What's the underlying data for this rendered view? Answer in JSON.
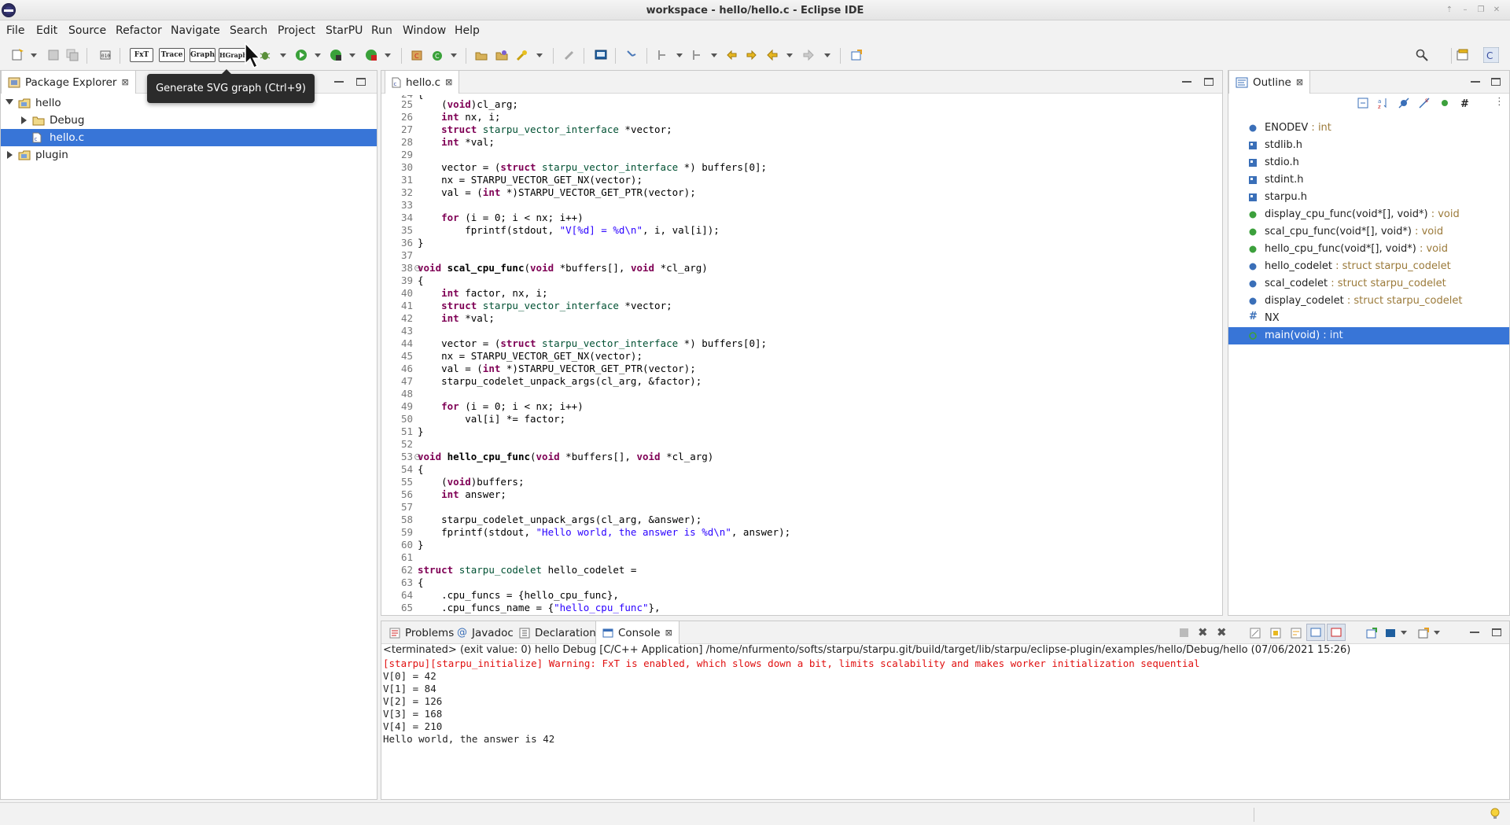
{
  "window": {
    "title": "workspace - hello/hello.c - Eclipse IDE"
  },
  "menubar": [
    "File",
    "Edit",
    "Source",
    "Refactor",
    "Navigate",
    "Search",
    "Project",
    "StarPU",
    "Run",
    "Window",
    "Help"
  ],
  "toolbar": {
    "starpu_buttons": [
      "FxT",
      "Trace",
      "Graph",
      "HGraph"
    ],
    "tooltip": "Generate SVG graph (Ctrl+9)"
  },
  "package_explorer": {
    "tab_label": "Package Explorer",
    "items": [
      {
        "label": "hello",
        "indent": 0,
        "expanded": true,
        "icon": "project-icon"
      },
      {
        "label": "Debug",
        "indent": 1,
        "expanded": false,
        "icon": "folder-icon"
      },
      {
        "label": "hello.c",
        "indent": 1,
        "selected": true,
        "icon": "c-file-icon"
      },
      {
        "label": "plugin",
        "indent": 0,
        "expanded": false,
        "icon": "project-icon"
      }
    ]
  },
  "editor": {
    "tab_label": "hello.c",
    "lines": [
      {
        "n": "25",
        "t": "    (void)cl_arg;"
      },
      {
        "n": "26",
        "t": "    int nx, i;"
      },
      {
        "n": "27",
        "t": "    struct starpu_vector_interface *vector;"
      },
      {
        "n": "28",
        "t": "    int *val;"
      },
      {
        "n": "29",
        "t": ""
      },
      {
        "n": "30",
        "t": "    vector = (struct starpu_vector_interface *) buffers[0];"
      },
      {
        "n": "31",
        "t": "    nx = STARPU_VECTOR_GET_NX(vector);"
      },
      {
        "n": "32",
        "t": "    val = (int *)STARPU_VECTOR_GET_PTR(vector);"
      },
      {
        "n": "33",
        "t": ""
      },
      {
        "n": "34",
        "t": "    for (i = 0; i < nx; i++)"
      },
      {
        "n": "35",
        "t": "        fprintf(stdout, \"V[%d] = %d\\n\", i, val[i]);"
      },
      {
        "n": "36",
        "t": "}"
      },
      {
        "n": "37",
        "t": ""
      },
      {
        "n": "38",
        "t": "void scal_cpu_func(void *buffers[], void *cl_arg)",
        "fold": true
      },
      {
        "n": "39",
        "t": "{"
      },
      {
        "n": "40",
        "t": "    int factor, nx, i;"
      },
      {
        "n": "41",
        "t": "    struct starpu_vector_interface *vector;"
      },
      {
        "n": "42",
        "t": "    int *val;"
      },
      {
        "n": "43",
        "t": ""
      },
      {
        "n": "44",
        "t": "    vector = (struct starpu_vector_interface *) buffers[0];"
      },
      {
        "n": "45",
        "t": "    nx = STARPU_VECTOR_GET_NX(vector);"
      },
      {
        "n": "46",
        "t": "    val = (int *)STARPU_VECTOR_GET_PTR(vector);"
      },
      {
        "n": "47",
        "t": "    starpu_codelet_unpack_args(cl_arg, &factor);"
      },
      {
        "n": "48",
        "t": ""
      },
      {
        "n": "49",
        "t": "    for (i = 0; i < nx; i++)"
      },
      {
        "n": "50",
        "t": "        val[i] *= factor;"
      },
      {
        "n": "51",
        "t": "}"
      },
      {
        "n": "52",
        "t": ""
      },
      {
        "n": "53",
        "t": "void hello_cpu_func(void *buffers[], void *cl_arg)",
        "fold": true
      },
      {
        "n": "54",
        "t": "{"
      },
      {
        "n": "55",
        "t": "    (void)buffers;"
      },
      {
        "n": "56",
        "t": "    int answer;"
      },
      {
        "n": "57",
        "t": ""
      },
      {
        "n": "58",
        "t": "    starpu_codelet_unpack_args(cl_arg, &answer);"
      },
      {
        "n": "59",
        "t": "    fprintf(stdout, \"Hello world, the answer is %d\\n\", answer);"
      },
      {
        "n": "60",
        "t": "}"
      },
      {
        "n": "61",
        "t": ""
      },
      {
        "n": "62",
        "t": "struct starpu_codelet hello_codelet ="
      },
      {
        "n": "63",
        "t": "{"
      },
      {
        "n": "64",
        "t": "    .cpu_funcs = {hello_cpu_func},"
      },
      {
        "n": "65",
        "t": "    .cpu_funcs_name = {\"hello_cpu_func\"},"
      }
    ]
  },
  "outline": {
    "tab_label": "Outline",
    "items": [
      {
        "name": "ENODEV",
        "type": " : int",
        "icon": "field-icon",
        "color": "#3a6fb8"
      },
      {
        "name": "stdlib.h",
        "type": "",
        "icon": "include-icon",
        "color": "#3a6fb8"
      },
      {
        "name": "stdio.h",
        "type": "",
        "icon": "include-icon",
        "color": "#3a6fb8"
      },
      {
        "name": "stdint.h",
        "type": "",
        "icon": "include-icon",
        "color": "#3a6fb8"
      },
      {
        "name": "starpu.h",
        "type": "",
        "icon": "include-icon",
        "color": "#3a6fb8"
      },
      {
        "name": "display_cpu_func(void*[], void*)",
        "type": " : void",
        "icon": "function-icon",
        "color": "#3ca03c"
      },
      {
        "name": "scal_cpu_func(void*[], void*)",
        "type": " : void",
        "icon": "function-icon",
        "color": "#3ca03c"
      },
      {
        "name": "hello_cpu_func(void*[], void*)",
        "type": " : void",
        "icon": "function-icon",
        "color": "#3ca03c"
      },
      {
        "name": "hello_codelet",
        "type": " : struct starpu_codelet",
        "icon": "variable-icon",
        "color": "#3a6fb8"
      },
      {
        "name": "scal_codelet",
        "type": " : struct starpu_codelet",
        "icon": "variable-icon",
        "color": "#3a6fb8"
      },
      {
        "name": "display_codelet",
        "type": " : struct starpu_codelet",
        "icon": "variable-icon",
        "color": "#3a6fb8"
      },
      {
        "name": "NX",
        "type": "",
        "icon": "macro-icon",
        "color": "#3a6fb8"
      },
      {
        "name": "main(void)",
        "type": " : int",
        "icon": "function-icon",
        "color": "#3ca03c",
        "selected": true
      }
    ]
  },
  "bottom_tabs": [
    {
      "label": "Problems",
      "icon": "problems-icon"
    },
    {
      "label": "Javadoc",
      "icon": "javadoc-icon"
    },
    {
      "label": "Declaration",
      "icon": "declaration-icon"
    },
    {
      "label": "Console",
      "icon": "console-icon",
      "active": true
    }
  ],
  "console": {
    "header": "<terminated> (exit value: 0) hello Debug [C/C++ Application] /home/nfurmento/softs/starpu/starpu.git/build/target/lib/starpu/eclipse-plugin/examples/hello/Debug/hello (07/06/2021 15:26)",
    "warning": "[starpu][starpu_initialize] Warning: FxT is enabled, which slows down a bit, limits scalability and makes worker initialization sequential",
    "output": [
      "V[0] = 42",
      "V[1] = 84",
      "V[2] = 126",
      "V[3] = 168",
      "V[4] = 210",
      "Hello world, the answer is 42"
    ]
  },
  "colors": {
    "selection": "#3875d7",
    "warning_text": "#e01010",
    "keyword": "#7f0055",
    "string": "#2a00ff",
    "type": "#005032"
  }
}
